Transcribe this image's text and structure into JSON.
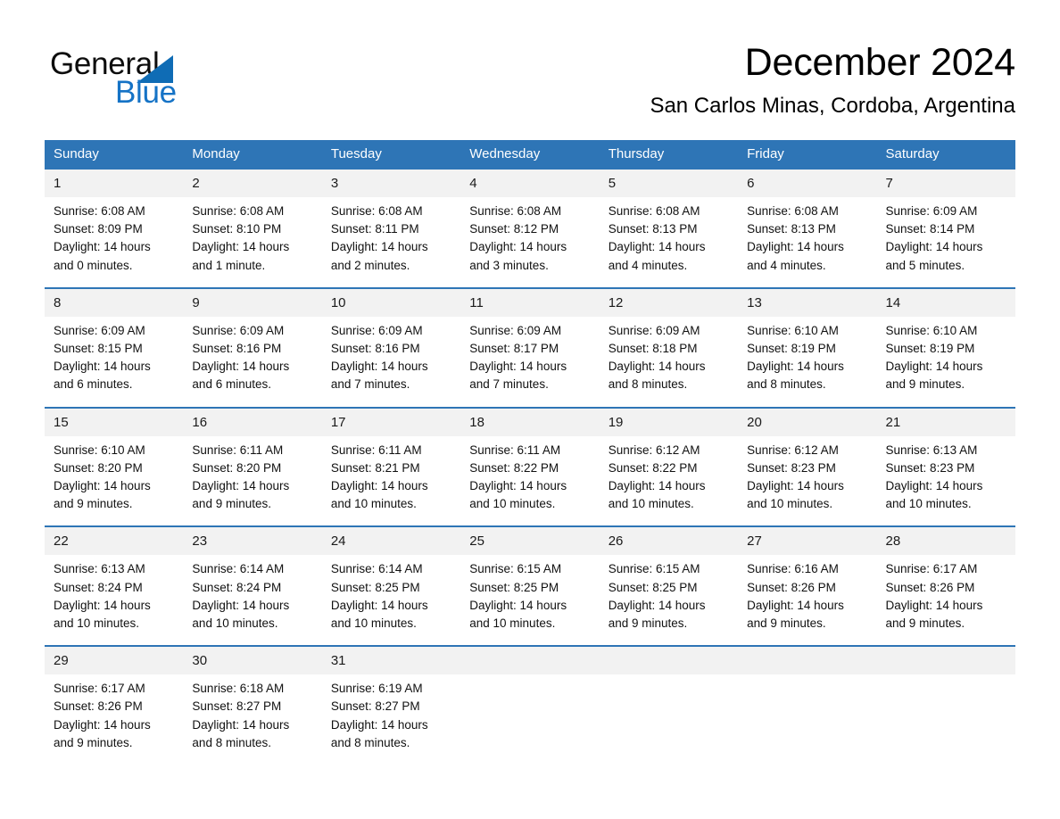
{
  "brand": {
    "name_part1": "General",
    "name_part2": "Blue",
    "triangle_color": "#0f6cb5",
    "blue_text_color": "#1573c6"
  },
  "header": {
    "title": "December 2024",
    "subtitle": "San Carlos Minas, Cordoba, Argentina"
  },
  "theme": {
    "header_blue": "#2e75b6",
    "daynum_band": "#f2f2f2",
    "rule_blue": "#2e75b6"
  },
  "calendar": {
    "weekday_headers": [
      "Sunday",
      "Monday",
      "Tuesday",
      "Wednesday",
      "Thursday",
      "Friday",
      "Saturday"
    ],
    "weeks": [
      {
        "days": [
          {
            "num": "1",
            "sunrise": "Sunrise: 6:08 AM",
            "sunset": "Sunset: 8:09 PM",
            "daylight_1": "Daylight: 14 hours",
            "daylight_2": "and 0 minutes."
          },
          {
            "num": "2",
            "sunrise": "Sunrise: 6:08 AM",
            "sunset": "Sunset: 8:10 PM",
            "daylight_1": "Daylight: 14 hours",
            "daylight_2": "and 1 minute."
          },
          {
            "num": "3",
            "sunrise": "Sunrise: 6:08 AM",
            "sunset": "Sunset: 8:11 PM",
            "daylight_1": "Daylight: 14 hours",
            "daylight_2": "and 2 minutes."
          },
          {
            "num": "4",
            "sunrise": "Sunrise: 6:08 AM",
            "sunset": "Sunset: 8:12 PM",
            "daylight_1": "Daylight: 14 hours",
            "daylight_2": "and 3 minutes."
          },
          {
            "num": "5",
            "sunrise": "Sunrise: 6:08 AM",
            "sunset": "Sunset: 8:13 PM",
            "daylight_1": "Daylight: 14 hours",
            "daylight_2": "and 4 minutes."
          },
          {
            "num": "6",
            "sunrise": "Sunrise: 6:08 AM",
            "sunset": "Sunset: 8:13 PM",
            "daylight_1": "Daylight: 14 hours",
            "daylight_2": "and 4 minutes."
          },
          {
            "num": "7",
            "sunrise": "Sunrise: 6:09 AM",
            "sunset": "Sunset: 8:14 PM",
            "daylight_1": "Daylight: 14 hours",
            "daylight_2": "and 5 minutes."
          }
        ]
      },
      {
        "days": [
          {
            "num": "8",
            "sunrise": "Sunrise: 6:09 AM",
            "sunset": "Sunset: 8:15 PM",
            "daylight_1": "Daylight: 14 hours",
            "daylight_2": "and 6 minutes."
          },
          {
            "num": "9",
            "sunrise": "Sunrise: 6:09 AM",
            "sunset": "Sunset: 8:16 PM",
            "daylight_1": "Daylight: 14 hours",
            "daylight_2": "and 6 minutes."
          },
          {
            "num": "10",
            "sunrise": "Sunrise: 6:09 AM",
            "sunset": "Sunset: 8:16 PM",
            "daylight_1": "Daylight: 14 hours",
            "daylight_2": "and 7 minutes."
          },
          {
            "num": "11",
            "sunrise": "Sunrise: 6:09 AM",
            "sunset": "Sunset: 8:17 PM",
            "daylight_1": "Daylight: 14 hours",
            "daylight_2": "and 7 minutes."
          },
          {
            "num": "12",
            "sunrise": "Sunrise: 6:09 AM",
            "sunset": "Sunset: 8:18 PM",
            "daylight_1": "Daylight: 14 hours",
            "daylight_2": "and 8 minutes."
          },
          {
            "num": "13",
            "sunrise": "Sunrise: 6:10 AM",
            "sunset": "Sunset: 8:19 PM",
            "daylight_1": "Daylight: 14 hours",
            "daylight_2": "and 8 minutes."
          },
          {
            "num": "14",
            "sunrise": "Sunrise: 6:10 AM",
            "sunset": "Sunset: 8:19 PM",
            "daylight_1": "Daylight: 14 hours",
            "daylight_2": "and 9 minutes."
          }
        ]
      },
      {
        "days": [
          {
            "num": "15",
            "sunrise": "Sunrise: 6:10 AM",
            "sunset": "Sunset: 8:20 PM",
            "daylight_1": "Daylight: 14 hours",
            "daylight_2": "and 9 minutes."
          },
          {
            "num": "16",
            "sunrise": "Sunrise: 6:11 AM",
            "sunset": "Sunset: 8:20 PM",
            "daylight_1": "Daylight: 14 hours",
            "daylight_2": "and 9 minutes."
          },
          {
            "num": "17",
            "sunrise": "Sunrise: 6:11 AM",
            "sunset": "Sunset: 8:21 PM",
            "daylight_1": "Daylight: 14 hours",
            "daylight_2": "and 10 minutes."
          },
          {
            "num": "18",
            "sunrise": "Sunrise: 6:11 AM",
            "sunset": "Sunset: 8:22 PM",
            "daylight_1": "Daylight: 14 hours",
            "daylight_2": "and 10 minutes."
          },
          {
            "num": "19",
            "sunrise": "Sunrise: 6:12 AM",
            "sunset": "Sunset: 8:22 PM",
            "daylight_1": "Daylight: 14 hours",
            "daylight_2": "and 10 minutes."
          },
          {
            "num": "20",
            "sunrise": "Sunrise: 6:12 AM",
            "sunset": "Sunset: 8:23 PM",
            "daylight_1": "Daylight: 14 hours",
            "daylight_2": "and 10 minutes."
          },
          {
            "num": "21",
            "sunrise": "Sunrise: 6:13 AM",
            "sunset": "Sunset: 8:23 PM",
            "daylight_1": "Daylight: 14 hours",
            "daylight_2": "and 10 minutes."
          }
        ]
      },
      {
        "days": [
          {
            "num": "22",
            "sunrise": "Sunrise: 6:13 AM",
            "sunset": "Sunset: 8:24 PM",
            "daylight_1": "Daylight: 14 hours",
            "daylight_2": "and 10 minutes."
          },
          {
            "num": "23",
            "sunrise": "Sunrise: 6:14 AM",
            "sunset": "Sunset: 8:24 PM",
            "daylight_1": "Daylight: 14 hours",
            "daylight_2": "and 10 minutes."
          },
          {
            "num": "24",
            "sunrise": "Sunrise: 6:14 AM",
            "sunset": "Sunset: 8:25 PM",
            "daylight_1": "Daylight: 14 hours",
            "daylight_2": "and 10 minutes."
          },
          {
            "num": "25",
            "sunrise": "Sunrise: 6:15 AM",
            "sunset": "Sunset: 8:25 PM",
            "daylight_1": "Daylight: 14 hours",
            "daylight_2": "and 10 minutes."
          },
          {
            "num": "26",
            "sunrise": "Sunrise: 6:15 AM",
            "sunset": "Sunset: 8:25 PM",
            "daylight_1": "Daylight: 14 hours",
            "daylight_2": "and 9 minutes."
          },
          {
            "num": "27",
            "sunrise": "Sunrise: 6:16 AM",
            "sunset": "Sunset: 8:26 PM",
            "daylight_1": "Daylight: 14 hours",
            "daylight_2": "and 9 minutes."
          },
          {
            "num": "28",
            "sunrise": "Sunrise: 6:17 AM",
            "sunset": "Sunset: 8:26 PM",
            "daylight_1": "Daylight: 14 hours",
            "daylight_2": "and 9 minutes."
          }
        ]
      },
      {
        "days": [
          {
            "num": "29",
            "sunrise": "Sunrise: 6:17 AM",
            "sunset": "Sunset: 8:26 PM",
            "daylight_1": "Daylight: 14 hours",
            "daylight_2": "and 9 minutes."
          },
          {
            "num": "30",
            "sunrise": "Sunrise: 6:18 AM",
            "sunset": "Sunset: 8:27 PM",
            "daylight_1": "Daylight: 14 hours",
            "daylight_2": "and 8 minutes."
          },
          {
            "num": "31",
            "sunrise": "Sunrise: 6:19 AM",
            "sunset": "Sunset: 8:27 PM",
            "daylight_1": "Daylight: 14 hours",
            "daylight_2": "and 8 minutes."
          },
          {
            "num": "",
            "sunrise": "",
            "sunset": "",
            "daylight_1": "",
            "daylight_2": ""
          },
          {
            "num": "",
            "sunrise": "",
            "sunset": "",
            "daylight_1": "",
            "daylight_2": ""
          },
          {
            "num": "",
            "sunrise": "",
            "sunset": "",
            "daylight_1": "",
            "daylight_2": ""
          },
          {
            "num": "",
            "sunrise": "",
            "sunset": "",
            "daylight_1": "",
            "daylight_2": ""
          }
        ]
      }
    ]
  }
}
